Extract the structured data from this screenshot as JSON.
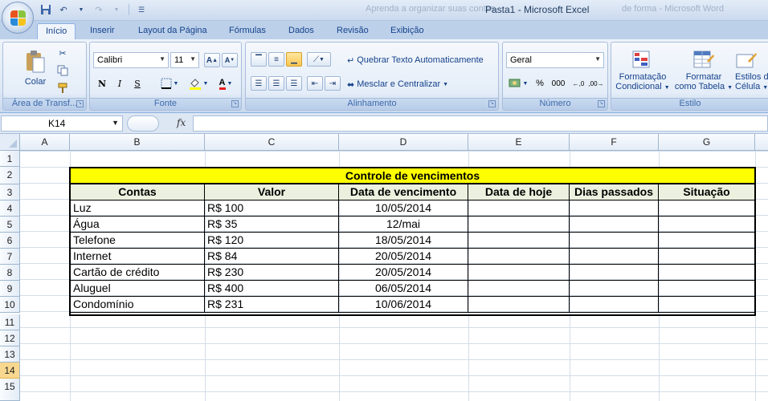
{
  "window": {
    "title": "Pasta1 - Microsoft Excel",
    "background_title_left": "Aprenda a organizar suas contas",
    "background_title_right": "de forma - Microsoft Word"
  },
  "tabs": [
    "Início",
    "Inserir",
    "Layout da Página",
    "Fórmulas",
    "Dados",
    "Revisão",
    "Exibição"
  ],
  "active_tab": "Início",
  "ribbon": {
    "clipboard": {
      "paste": "Colar",
      "label": "Área de Transf..."
    },
    "font": {
      "name": "Calibri",
      "size": "11",
      "label": "Fonte",
      "bold": "N",
      "italic": "I",
      "underline": "S"
    },
    "alignment": {
      "wrap": "Quebrar Texto Automaticamente",
      "merge": "Mesclar e Centralizar",
      "label": "Alinhamento"
    },
    "number": {
      "format": "Geral",
      "label": "Número",
      "percent": "%",
      "thousands": "000"
    },
    "style": {
      "conditional_1": "Formatação",
      "conditional_2": "Condicional",
      "table_1": "Formatar",
      "table_2": "como Tabela",
      "cell_1": "Estilos de",
      "cell_2": "Célula",
      "label": "Estilo"
    }
  },
  "formula_bar": {
    "cell_ref": "K14",
    "fx": "fx",
    "value": ""
  },
  "columns": [
    "A",
    "B",
    "C",
    "D",
    "E",
    "F",
    "G"
  ],
  "rows": [
    "1",
    "2",
    "3",
    "4",
    "5",
    "6",
    "7",
    "8",
    "9",
    "10",
    "11",
    "12",
    "13",
    "14",
    "15"
  ],
  "selected_row": "14",
  "sheet": {
    "title": "Controle de vencimentos",
    "headers": [
      "Contas",
      "Valor",
      "Data de vencimento",
      "Data de hoje",
      "Dias passados",
      "Situação"
    ],
    "rows": [
      [
        "Luz",
        "R$ 100",
        "10/05/2014",
        "",
        "",
        ""
      ],
      [
        "Água",
        "R$ 35",
        "12/mai",
        "",
        "",
        ""
      ],
      [
        "Telefone",
        "R$ 120",
        "18/05/2014",
        "",
        "",
        ""
      ],
      [
        "Internet",
        "R$ 84",
        "20/05/2014",
        "",
        "",
        ""
      ],
      [
        "Cartão de crédito",
        "R$ 230",
        "20/05/2014",
        "",
        "",
        ""
      ],
      [
        "Aluguel",
        "R$ 400",
        "06/05/2014",
        "",
        "",
        ""
      ],
      [
        "Condomínio",
        "R$ 231",
        "10/06/2014",
        "",
        "",
        ""
      ]
    ]
  },
  "colors": {
    "title_fill": "#ffff00",
    "header_fill": "#ebf1de",
    "selected_row": "#f8d88f"
  }
}
